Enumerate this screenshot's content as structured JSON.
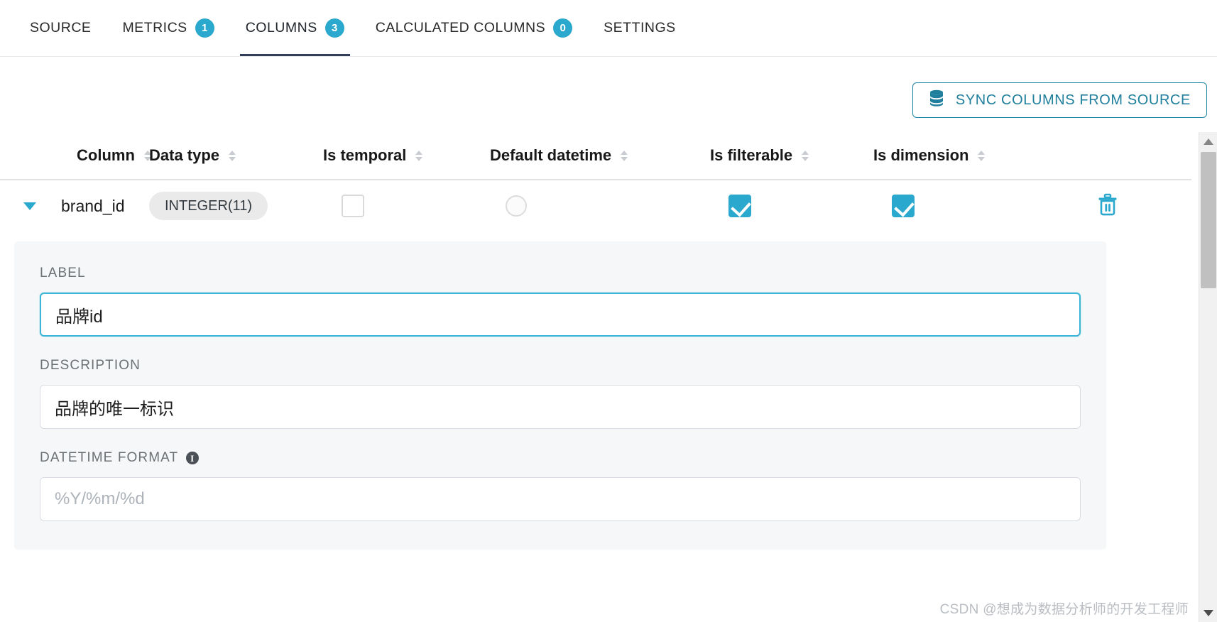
{
  "tabs": [
    {
      "label": "SOURCE",
      "badge": null,
      "active": false
    },
    {
      "label": "METRICS",
      "badge": "1",
      "active": false
    },
    {
      "label": "COLUMNS",
      "badge": "3",
      "active": true
    },
    {
      "label": "CALCULATED COLUMNS",
      "badge": "0",
      "active": false
    },
    {
      "label": "SETTINGS",
      "badge": null,
      "active": false
    }
  ],
  "toolbar": {
    "sync_label": "SYNC COLUMNS FROM SOURCE",
    "sync_icon": "database-icon"
  },
  "table": {
    "headers": [
      "Column",
      "Data type",
      "Is temporal",
      "Default datetime",
      "Is filterable",
      "Is dimension"
    ],
    "rows": [
      {
        "expanded": true,
        "column": "brand_id",
        "data_type": "INTEGER(11)",
        "is_temporal": false,
        "default_datetime": false,
        "is_filterable": true,
        "is_dimension": true,
        "delete_icon": "trash-icon"
      }
    ]
  },
  "detail_panel": {
    "label": {
      "caption": "LABEL",
      "value": "品牌id",
      "placeholder": "",
      "focused": true
    },
    "description": {
      "caption": "DESCRIPTION",
      "value": "品牌的唯一标识",
      "placeholder": "",
      "focused": false
    },
    "datetime_format": {
      "caption": "DATETIME FORMAT",
      "value": "",
      "placeholder": "%Y/%m/%d",
      "info_icon": "info-icon",
      "info_glyph": "i",
      "focused": false
    }
  },
  "scrollbar": {
    "up_icon": "chevron-up-icon",
    "down_icon": "chevron-down-icon"
  },
  "watermark": "CSDN @想成为数据分析师的开发工程师",
  "colors": {
    "accent": "#2aa8cd",
    "accent_dark": "#1f7f9c",
    "active_tab_underline": "#323c5b",
    "panel_bg": "#f6f7f8"
  }
}
